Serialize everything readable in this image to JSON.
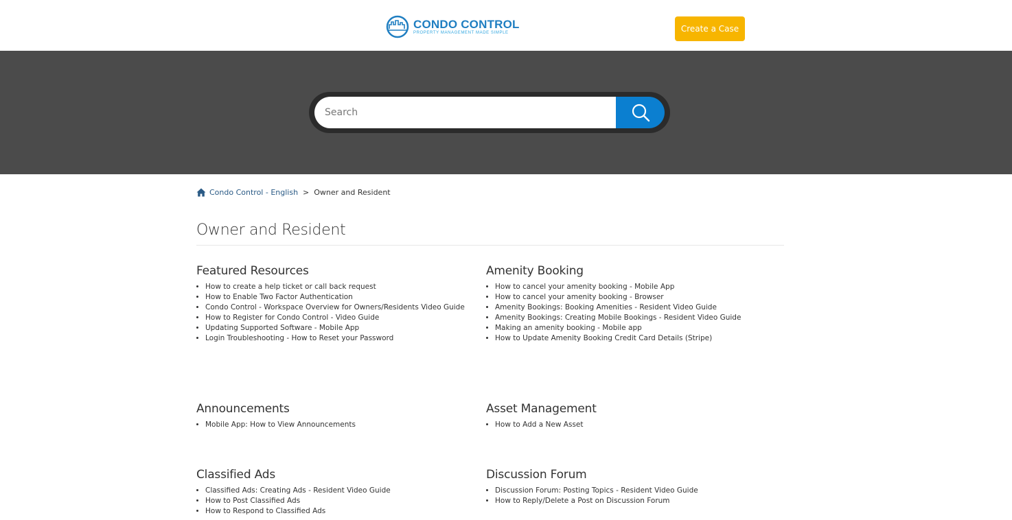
{
  "header": {
    "logo_title": "CONDO CONTROL",
    "logo_tagline": "PROPERTY MANAGEMENT MADE SIMPLE",
    "create_case_label": "Create a Case"
  },
  "search": {
    "placeholder": "Search",
    "icon": "search-icon"
  },
  "breadcrumb": {
    "home_link": "Condo Control - English",
    "separator": ">",
    "current": "Owner and Resident"
  },
  "page_title": "Owner and Resident",
  "sections": [
    {
      "title": "Featured Resources",
      "items": [
        "How to create a help ticket or call back request",
        "How to Enable Two Factor Authentication",
        "Condo Control - Workspace Overview for Owners/Residents Video Guide",
        "How to Register for Condo Control - Video Guide",
        "Updating Supported Software - Mobile App",
        "Login Troubleshooting - How to Reset your Password"
      ]
    },
    {
      "title": "Amenity Booking",
      "items": [
        "How to cancel your amenity booking - Mobile App",
        "How to cancel your amenity booking - Browser",
        "Amenity Bookings: Booking Amenities - Resident Video Guide",
        "Amenity Bookings: Creating Mobile Bookings - Resident Video Guide",
        "Making an amenity booking - Mobile app",
        "How to Update Amenity Booking Credit Card Details (Stripe)"
      ]
    },
    {
      "title": "Announcements",
      "items": [
        "Mobile App: How to View Announcements"
      ]
    },
    {
      "title": "Asset Management",
      "items": [
        "How to Add a New Asset"
      ]
    },
    {
      "title": "Classified Ads",
      "items": [
        "Classified Ads: Creating Ads - Resident Video Guide",
        "How to Post Classified Ads",
        "How to Respond to Classified Ads"
      ]
    },
    {
      "title": "Discussion Forum",
      "items": [
        "Discussion Forum: Posting Topics - Resident Video Guide",
        "How to Reply/Delete a Post on Discussion Forum"
      ]
    }
  ],
  "colors": {
    "brand_blue": "#1f7ec1",
    "accent_yellow": "#f7b500",
    "hero_bg": "#4b4b4b",
    "search_button": "#0b7fd0"
  }
}
